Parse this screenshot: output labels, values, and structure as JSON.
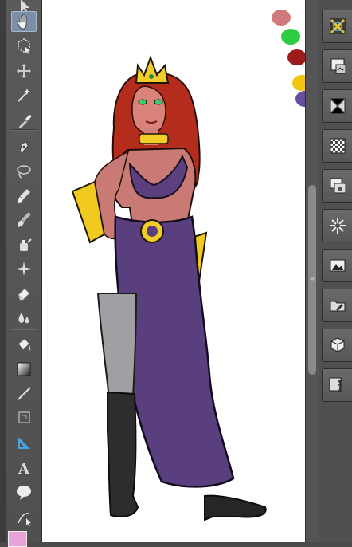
{
  "toolbar": {
    "tools": [
      {
        "name": "selection-arrow-tool",
        "icon": "arrow-icon",
        "active": false
      },
      {
        "name": "hand-tool",
        "icon": "hand-icon",
        "active": true
      },
      {
        "name": "select-cube-tool",
        "icon": "cube-select-icon",
        "active": false
      },
      {
        "name": "move-layer-tool",
        "icon": "move-icon",
        "active": false
      },
      {
        "name": "magic-wand-tool",
        "icon": "magic-wand-icon",
        "active": false
      },
      {
        "name": "eyedropper-tool",
        "icon": "eyedropper-icon",
        "active": false
      },
      {
        "name": "pen-tool",
        "icon": "pen-nib-icon",
        "active": false
      },
      {
        "name": "lasso-tool",
        "icon": "lasso-icon",
        "active": false
      },
      {
        "name": "brush-tool",
        "icon": "brush-icon",
        "active": false
      },
      {
        "name": "paint-brush-tool",
        "icon": "paint-brush-icon",
        "active": false
      },
      {
        "name": "airbrush-tool",
        "icon": "airbrush-icon",
        "active": false
      },
      {
        "name": "decoration-tool",
        "icon": "sparkle-icon",
        "active": false
      },
      {
        "name": "eraser-tool",
        "icon": "eraser-icon",
        "active": false
      },
      {
        "name": "blend-tool",
        "icon": "drops-icon",
        "active": false
      },
      {
        "name": "fill-tool",
        "icon": "paint-bucket-icon",
        "active": false
      },
      {
        "name": "gradient-tool",
        "icon": "gradient-icon",
        "active": false
      },
      {
        "name": "line-tool",
        "icon": "line-icon",
        "active": false
      },
      {
        "name": "frame-tool",
        "icon": "frame-icon",
        "active": false
      },
      {
        "name": "ruler-tool",
        "icon": "ruler-triangle-icon",
        "active": false
      },
      {
        "name": "text-tool",
        "icon": "text-icon",
        "active": false
      },
      {
        "name": "balloon-tool",
        "icon": "speech-balloon-icon",
        "active": false
      },
      {
        "name": "correct-line-tool",
        "icon": "vector-correct-icon",
        "active": false
      }
    ],
    "text_tool_glyph": "A",
    "foreground_color": "#e8a1d9"
  },
  "canvas": {
    "background": "#ffffff",
    "swatches": [
      "#d07a7a",
      "#2ecc40",
      "#9c1c1c",
      "#f1c40f",
      "#6a4fa0"
    ]
  },
  "panel": {
    "buttons": [
      {
        "name": "navigator-panel-button",
        "icon": "navigator-icon"
      },
      {
        "name": "sub-view-panel-button",
        "icon": "sub-view-icon"
      },
      {
        "name": "transform-panel-button",
        "icon": "transform-icon"
      },
      {
        "name": "transparency-panel-button",
        "icon": "checkerboard-icon"
      },
      {
        "name": "layer-panel-button",
        "icon": "layers-icon"
      },
      {
        "name": "material-panel-button",
        "icon": "material-icon"
      },
      {
        "name": "image-material-panel-button",
        "icon": "image-icon"
      },
      {
        "name": "edit-folder-panel-button",
        "icon": "folder-edit-icon"
      },
      {
        "name": "3d-material-panel-button",
        "icon": "3d-box-icon"
      },
      {
        "name": "pose-material-panel-button",
        "icon": "figure-icon"
      }
    ]
  }
}
